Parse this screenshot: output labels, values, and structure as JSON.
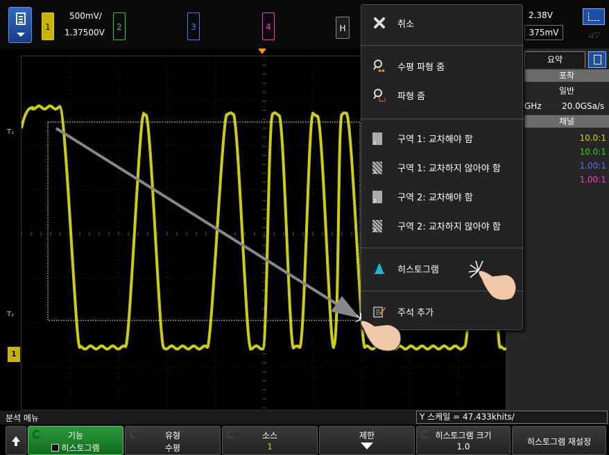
{
  "topbar": {
    "ch1_label": "1",
    "ch2_label": "2",
    "ch3_label": "3",
    "ch4_label": "4",
    "ch1_scale": "500mV/",
    "ch1_offset": "1.37500V",
    "horizontal_label": "H",
    "trigger_level": "2.38V",
    "trigger_box_value": "375mV"
  },
  "graticule": {
    "trace_color": "#e6e600",
    "marker_t1": "T₁",
    "marker_t2": "T₂",
    "ground_label": "1"
  },
  "side_panel": {
    "summary_tab": "요약",
    "acquisition_header": "포착",
    "acquisition_mode": "일반",
    "bandwidth": "GHz",
    "sample_rate": "20.0GSa/s",
    "channels_header": "채널",
    "probes": [
      "10.0:1",
      "10.0:1",
      "1.00:1",
      "1.00:1"
    ],
    "colors": {
      "ch1": "#e0d000",
      "ch2": "#2cd62c",
      "ch3": "#5575ff",
      "ch4": "#ff3ad0"
    }
  },
  "popup_menu": {
    "cancel": "취소",
    "horizontal_zoom": "수평 파형 줌",
    "waveform_zoom": "파형 줌",
    "zone1_must_intersect": "구역 1: 교차해야 함",
    "zone1_must_not_intersect": "구역 1: 교차하지 않아야 함",
    "zone2_must_intersect": "구역 2: 교차해야 함",
    "zone2_must_not_intersect": "구역 2: 교차하지 않아야 함",
    "histogram": "히스토그램",
    "add_annotation": "주석 추가",
    "zone1_digit": "1",
    "zone2_digit": "2"
  },
  "status": {
    "menu_name": "분석 메뉴",
    "y_scale": "Y 스케일 = 47.433khits/"
  },
  "softkeys": {
    "function_top": "기능",
    "function_bottom": "히스토그램",
    "type_top": "유형",
    "type_bottom": "수평",
    "source_top": "소스",
    "source_bottom": "1",
    "limits_top": "제한",
    "hist_size_top": "히스토그램 크기",
    "hist_size_bottom": "1.0",
    "hist_reset": "히스토그램 재설정"
  }
}
